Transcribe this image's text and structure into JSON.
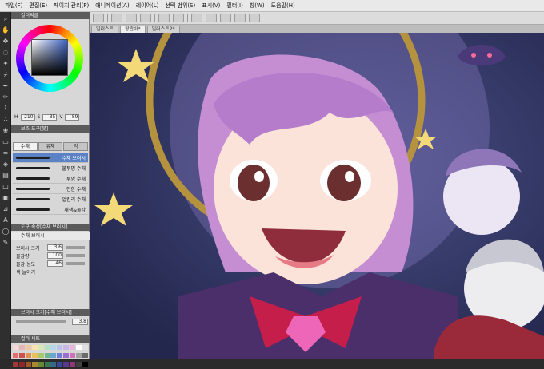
{
  "menubar": [
    "파일(F)",
    "편집(E)",
    "페이지 관리(P)",
    "애니메이션(A)",
    "레이어(L)",
    "선택 범위(S)",
    "표시(V)",
    "필터(I)",
    "창(W)",
    "도움말(H)"
  ],
  "tabs": [
    "일러스트",
    "왕관바*",
    "일러스트2*"
  ],
  "panels": {
    "color_wheel": "컬러써클",
    "brush": "보조 도구[붓]",
    "tool_property": "도구 속성[수채 브러시]",
    "brush_size": "브러시 크기[수채 브러시]",
    "color_set": "컬러 세트"
  },
  "color": {
    "h": "210",
    "s": "35",
    "v": "89",
    "main": "#3f63c2"
  },
  "brush_tabs": [
    "수채",
    "유채",
    "먹"
  ],
  "brushes": [
    "수채 브러시",
    "불투명 수채",
    "투명 수채",
    "전한 수채",
    "얼킨리 수채",
    "재색&물감"
  ],
  "brush_selected": "수채 브러시",
  "properties": [
    {
      "label": "브러시 크기",
      "value": "3.6"
    },
    {
      "label": "물감량",
      "value": "100"
    },
    {
      "label": "물감 농도",
      "value": "46"
    },
    {
      "label": "색 늘이기",
      "value": ""
    }
  ],
  "brush_size_value": "3.8",
  "palette": [
    "#f5d7d7",
    "#e9b4b4",
    "#f0c8a0",
    "#f7e3b0",
    "#d9e7b6",
    "#b6dfc3",
    "#b5d6e8",
    "#b8c2ec",
    "#cbb6e8",
    "#e7b6dc",
    "#ffffff",
    "#e0e0e0",
    "#e07070",
    "#d05050",
    "#e09050",
    "#e8c060",
    "#a8c870",
    "#6cb88c",
    "#6aa8d0",
    "#7080d8",
    "#9a70d0",
    "#d070b8",
    "#a0a0a0",
    "#6a6a6a",
    "#a03838",
    "#902828",
    "#a05828",
    "#a88830",
    "#688838",
    "#3a7850",
    "#386888",
    "#384898",
    "#5a3890",
    "#903878",
    "#404040",
    "#000000"
  ],
  "colors": {
    "accent": "#5c82c6",
    "panel": "#d7d7d7",
    "header": "#5b5b5b"
  }
}
